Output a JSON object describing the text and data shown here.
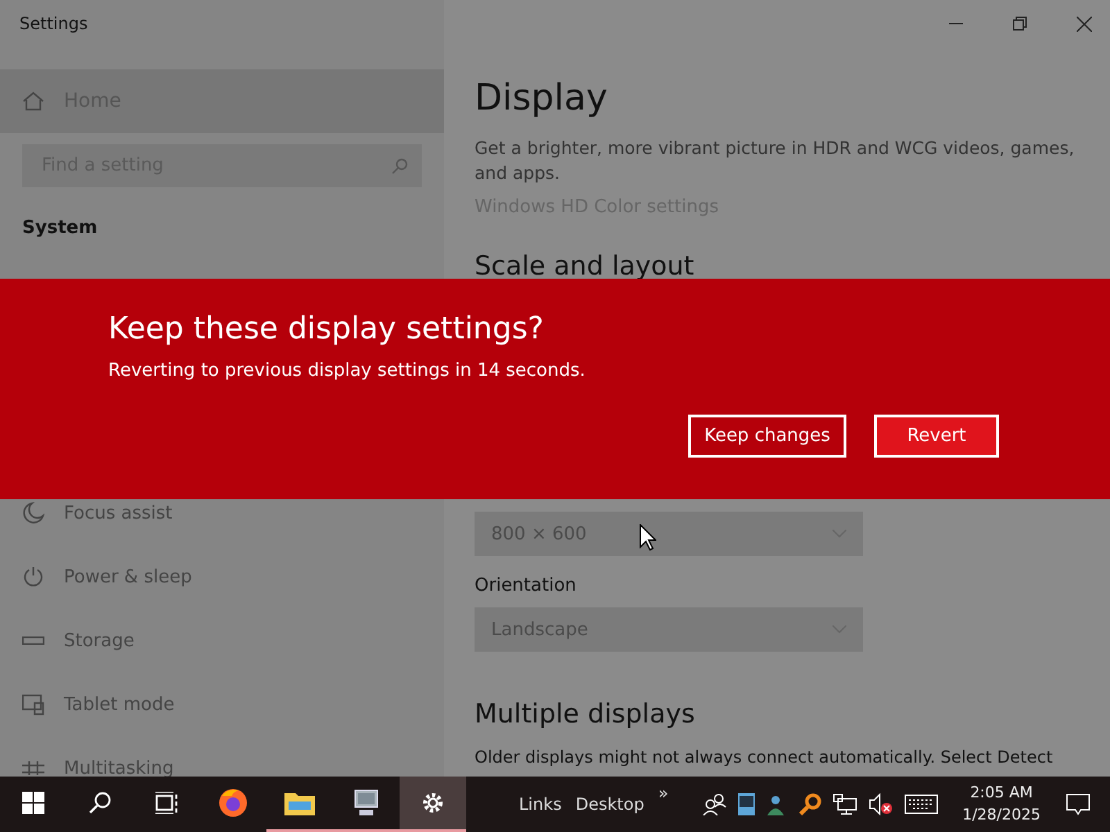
{
  "window": {
    "title": "Settings"
  },
  "sidebar": {
    "home": {
      "label": "Home",
      "selected": true
    },
    "search": {
      "placeholder": "Find a setting"
    },
    "section": "System",
    "items": [
      {
        "label": "Focus assist",
        "kind": "moon"
      },
      {
        "label": "Power & sleep",
        "kind": "power"
      },
      {
        "label": "Storage",
        "kind": "storage"
      },
      {
        "label": "Tablet mode",
        "kind": "tablet"
      },
      {
        "label": "Multitasking",
        "kind": "multitask"
      }
    ]
  },
  "content": {
    "title": "Display",
    "description": "Get a brighter, more vibrant picture in HDR and WCG videos, games, and apps.",
    "link": "Windows HD Color settings",
    "scale_heading": "Scale and layout",
    "resolution": {
      "value": "800 × 600",
      "disabled": true
    },
    "orientation": {
      "label": "Orientation",
      "value": "Landscape",
      "disabled": true
    },
    "multiple_heading": "Multiple displays",
    "multiple_text": "Older displays might not always connect automatically. Select Detect"
  },
  "dialog": {
    "title": "Keep these display settings?",
    "message": "Reverting to previous display settings in 14 seconds.",
    "buttons": [
      {
        "label": "Keep changes",
        "kind": "outline"
      },
      {
        "label": "Revert",
        "kind": "filled"
      }
    ]
  },
  "taskbar": {
    "apps": [
      {
        "kind": "start",
        "running": false,
        "selected": false
      },
      {
        "kind": "search",
        "running": false,
        "selected": false
      },
      {
        "kind": "taskview",
        "running": false,
        "selected": false
      },
      {
        "kind": "firefox",
        "running": false,
        "selected": false
      },
      {
        "kind": "folder",
        "running": true,
        "selected": false
      },
      {
        "kind": "computer",
        "running": true,
        "selected": false
      },
      {
        "kind": "settings",
        "running": true,
        "selected": true
      }
    ],
    "toolbars": [
      "Links",
      "Desktop"
    ],
    "overflow": "»",
    "volume_muted": true,
    "time": "2:05 AM",
    "date": "1/28/2025"
  }
}
